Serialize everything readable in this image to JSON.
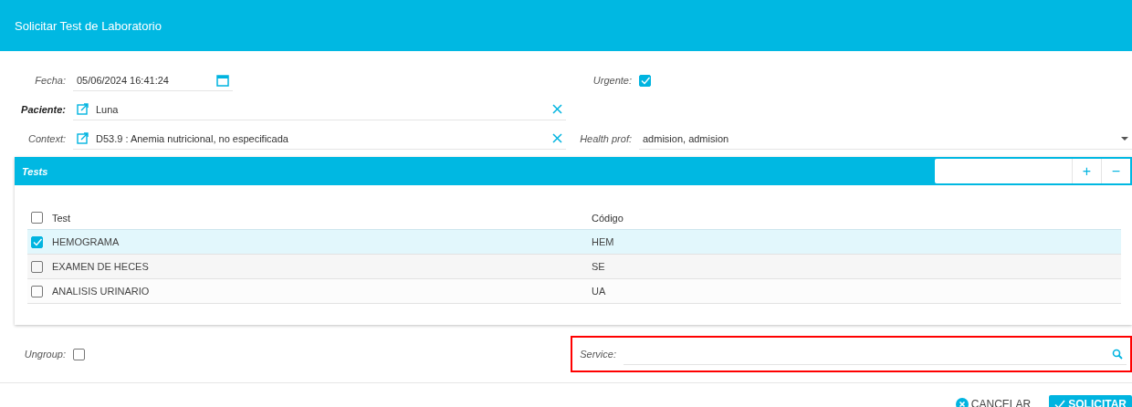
{
  "window": {
    "title": "Solicitar Test de Laboratorio"
  },
  "form": {
    "fecha": {
      "label": "Fecha:",
      "value": "05/06/2024 16:41:24"
    },
    "urgente": {
      "label": "Urgente:",
      "checked": true
    },
    "paciente": {
      "label": "Paciente:",
      "value": "Luna"
    },
    "context": {
      "label": "Context:",
      "value": "D53.9 : Anemia nutricional, no especificada"
    },
    "health_prof": {
      "label": "Health prof:",
      "value": "admision, admision"
    }
  },
  "tests": {
    "title": "Tests",
    "add": "+",
    "remove": "−",
    "columns": [
      "Test",
      "Código"
    ],
    "all_checked": false,
    "rows": [
      {
        "test": "HEMOGRAMA",
        "code": "HEM",
        "selected": true
      },
      {
        "test": "EXAMEN DE HECES",
        "code": "SE",
        "selected": false
      },
      {
        "test": "ANALISIS URINARIO",
        "code": "UA",
        "selected": false
      }
    ]
  },
  "ungroup": {
    "label": "Ungroup:",
    "checked": false
  },
  "service": {
    "label": "Service:",
    "highlighted": true
  },
  "buttons": [
    {
      "kind": "cancel",
      "label": "CANCELAR"
    },
    {
      "kind": "submit",
      "label": "SOLICITAR"
    }
  ]
}
